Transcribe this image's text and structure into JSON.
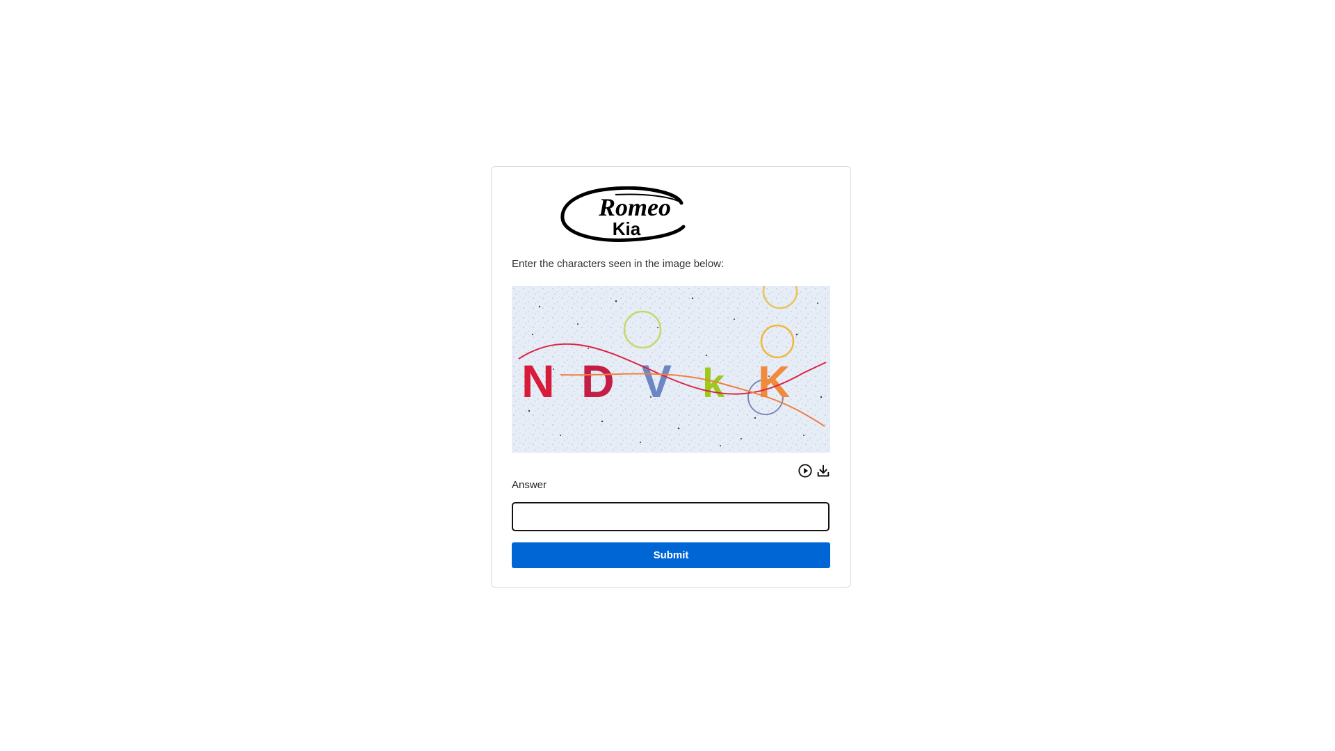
{
  "brand": {
    "logo_line1": "Romeo",
    "logo_line2": "Kia"
  },
  "captcha": {
    "prompt": "Enter the characters seen in the image below:",
    "characters": [
      "N",
      "D",
      "V",
      "k",
      "K"
    ],
    "character_colors": [
      "#d81b3a",
      "#c41e46",
      "#6d86c4",
      "#9cc91a",
      "#f08a3c"
    ],
    "audio_icon": "play-circle-icon",
    "download_icon": "download-icon"
  },
  "form": {
    "answer_label": "Answer",
    "answer_value": "",
    "submit_label": "Submit"
  },
  "colors": {
    "accent": "#0066d6",
    "card_border": "#dcdcdc"
  }
}
